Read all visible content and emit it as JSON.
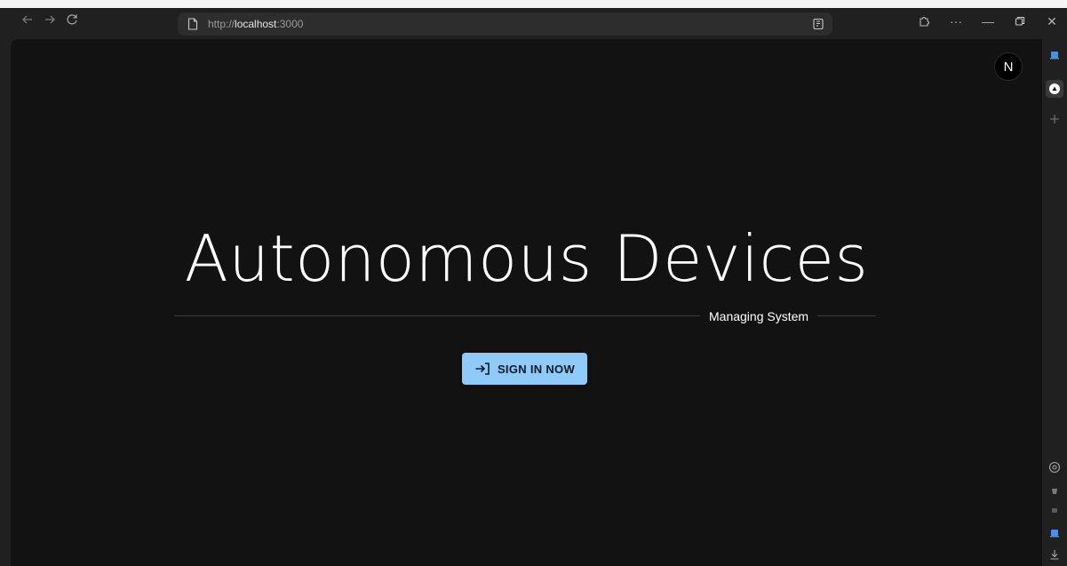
{
  "browser": {
    "url_prefix": "http://",
    "url_host": "localhost",
    "url_suffix": ":3000",
    "nav": {
      "back_icon": "arrow-left-icon",
      "forward_icon": "arrow-right-icon",
      "reload_icon": "reload-icon"
    },
    "window_controls": {
      "extensions_icon": "puzzle-icon",
      "more_label": "···",
      "minimize_label": "—",
      "restore_icon": "restore-icon",
      "close_label": "✕"
    }
  },
  "page": {
    "badge_label": "N",
    "title": "Autonomous Devices",
    "subtitle": "Managing System",
    "signin_label": "SIGN IN NOW",
    "signin_icon": "login-icon"
  },
  "colors": {
    "page_bg": "#121212",
    "browser_bg": "#202020",
    "button_bg": "#90caf9",
    "button_text": "#0d1a26",
    "accent_blue": "#4a90e2"
  }
}
